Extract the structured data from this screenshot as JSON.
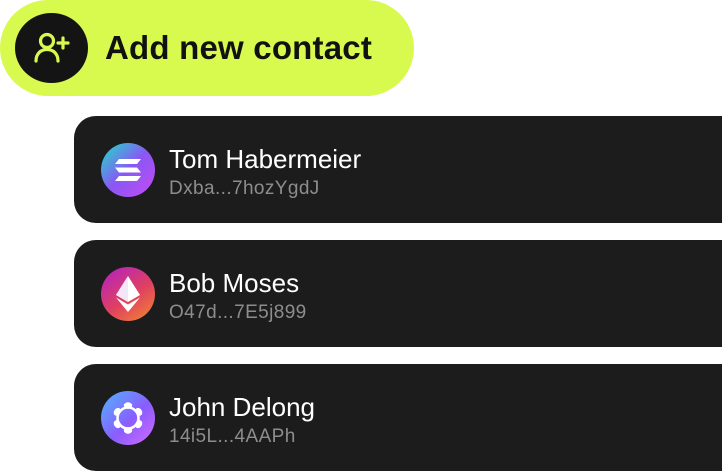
{
  "add_contact": {
    "label": "Add new contact",
    "icon": "add-user-icon",
    "accent_color": "#d8f94e"
  },
  "contacts": [
    {
      "name": "Tom Habermeier",
      "address": "Dxba...7hozYgdJ",
      "coin_icon": "solana-icon"
    },
    {
      "name": "Bob Moses",
      "address": "O47d...7E5j899",
      "coin_icon": "ethereum-icon"
    },
    {
      "name": "John Delong",
      "address": "14i5L...4AAPh",
      "coin_icon": "polkadot-icon"
    }
  ]
}
